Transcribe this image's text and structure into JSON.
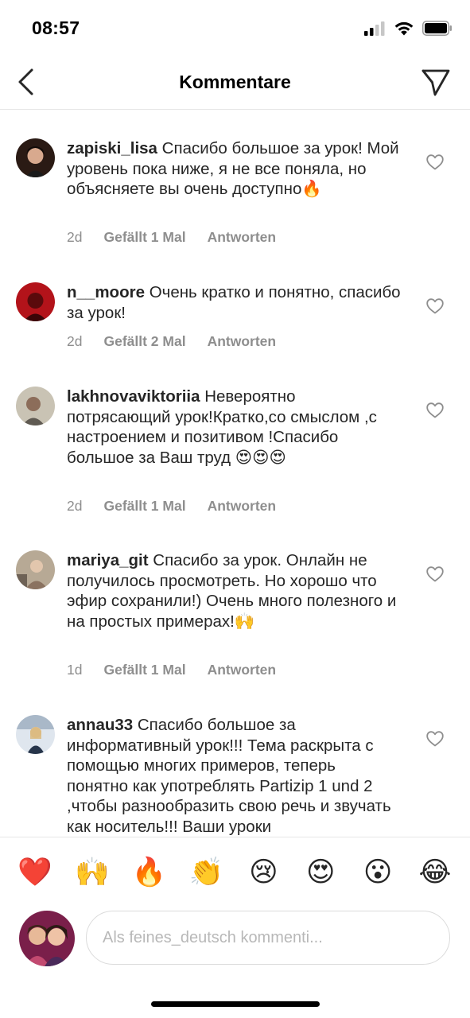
{
  "status": {
    "time": "08:57"
  },
  "nav": {
    "title": "Kommentare"
  },
  "comments": [
    {
      "user": "zapiski_lisa",
      "text": "Спасибо большое за урок! Мой уровень пока ниже, я не все поняла, но объясняете вы очень доступно🔥",
      "age": "2d",
      "likes": "Gefällt 1 Mal",
      "reply": "Antworten"
    },
    {
      "user": "n__moore",
      "text": "Очень кратко и понятно, спасибо за урок!",
      "age": "2d",
      "likes": "Gefällt 2 Mal",
      "reply": "Antworten"
    },
    {
      "user": "lakhnovaviktoriia",
      "text": "Невероятно потрясающий урок!Кратко,со смыслом ,с настроением и позитивом !Спасибо большое за Ваш труд 😍😍😍",
      "age": "2d",
      "likes": "Gefällt 1 Mal",
      "reply": "Antworten"
    },
    {
      "user": "mariya_git",
      "text": "Спасибо за урок. Онлайн не получилось просмотреть. Но хорошо что эфир сохранили!) Очень много полезного и на простых примерах!🙌",
      "age": "1d",
      "likes": "Gefällt 1 Mal",
      "reply": "Antworten"
    },
    {
      "user": "annau33",
      "text": "Спасибо большое за информативный урок!!! Тема раскрыта с помощью многих примеров, теперь понятно как употреблять Partizip 1 und 2 ,чтобы разнообразить свою речь и звучать как носитель!!! Ваши уроки",
      "age": "",
      "likes": "",
      "reply": ""
    }
  ],
  "emoji_bar": [
    "❤️",
    "🙌",
    "🔥",
    "👏",
    "😢",
    "😍",
    "😮",
    "😂"
  ],
  "composer": {
    "placeholder": "Als feines_deutsch kommenti..."
  },
  "colors": {
    "text": "#262626",
    "meta": "#8e8e8e",
    "divider": "#e6e6e6"
  },
  "icons": {
    "back": "chevron-left-icon",
    "send": "paper-plane-icon",
    "like": "heart-outline-icon"
  }
}
